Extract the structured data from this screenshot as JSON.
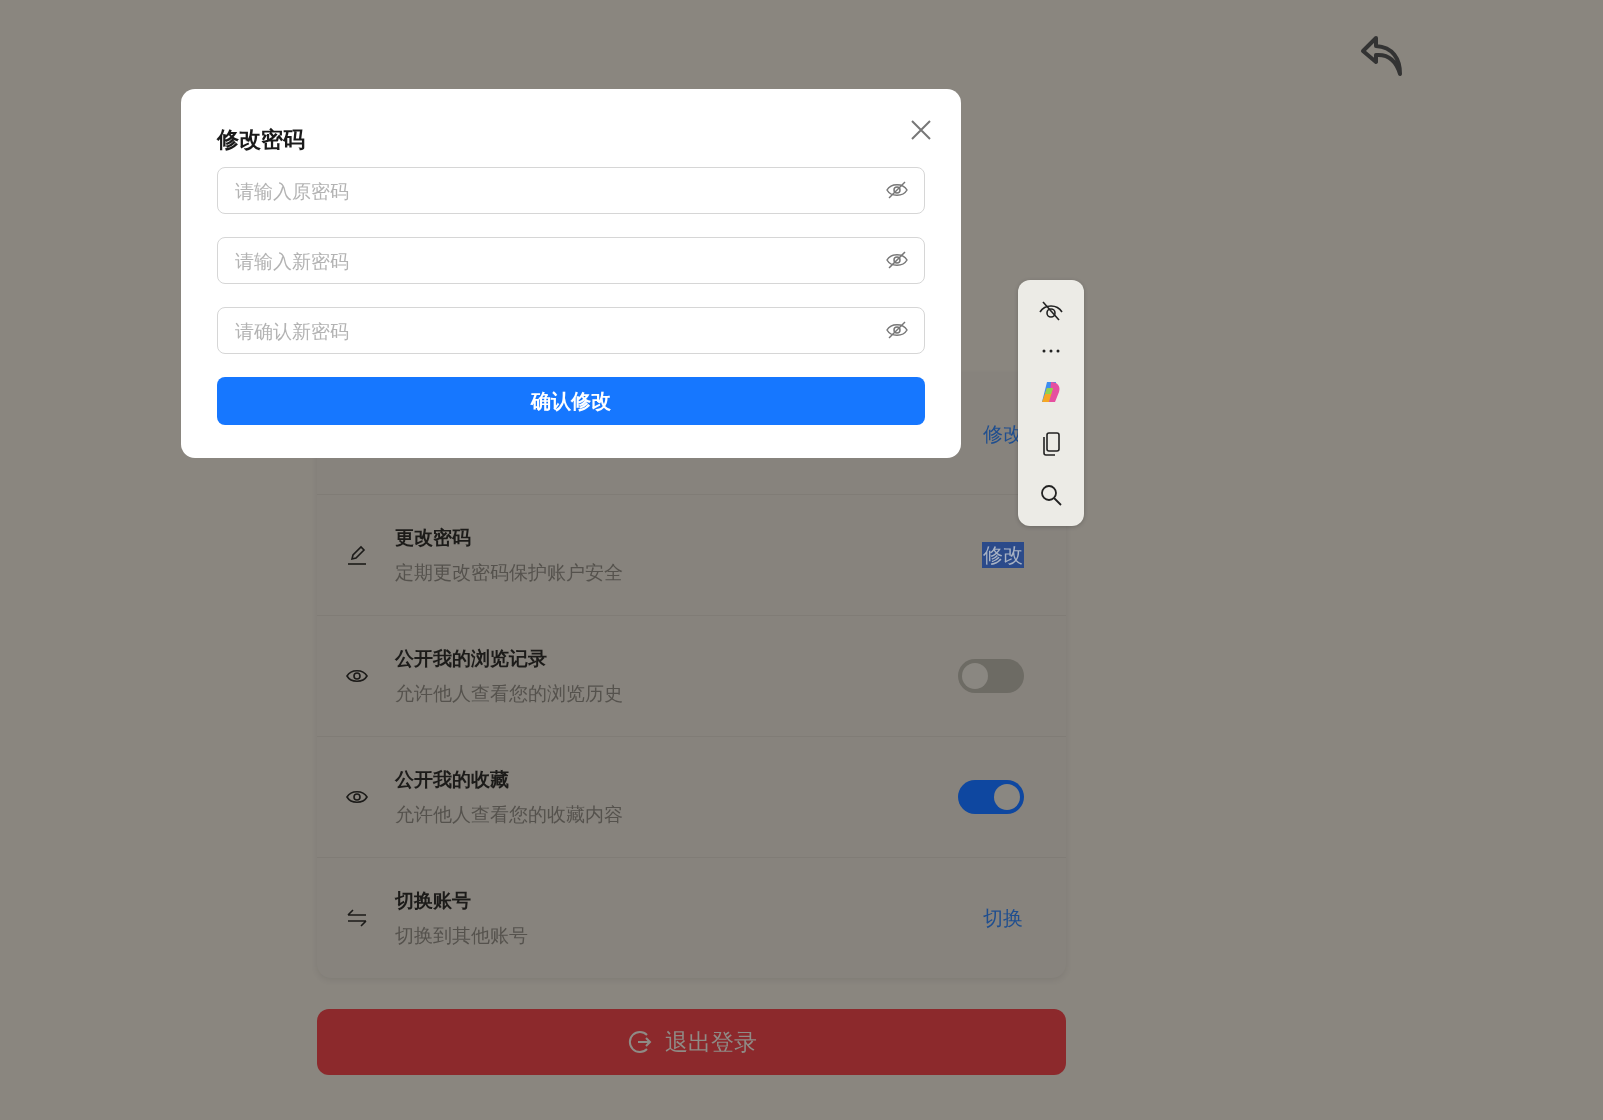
{
  "settings_rows": [
    {
      "kind": "link",
      "action": "修改",
      "highlighted": false
    },
    {
      "kind": "link",
      "title": "更改密码",
      "subtitle": "定期更改密码保护账户安全",
      "action": "修改",
      "highlighted": true
    },
    {
      "kind": "toggle",
      "title": "公开我的浏览记录",
      "subtitle": "允许他人查看您的浏览历史",
      "on": false
    },
    {
      "kind": "toggle",
      "title": "公开我的收藏",
      "subtitle": "允许他人查看您的收藏内容",
      "on": true
    },
    {
      "kind": "link",
      "title": "切换账号",
      "subtitle": "切换到其他账号",
      "action": "切换",
      "highlighted": false
    }
  ],
  "logout_button": "退出登录",
  "dialog": {
    "title": "修改密码",
    "fields": [
      {
        "placeholder": "请输入原密码"
      },
      {
        "placeholder": "请输入新密码"
      },
      {
        "placeholder": "请确认新密码"
      }
    ],
    "submit": "确认修改"
  }
}
